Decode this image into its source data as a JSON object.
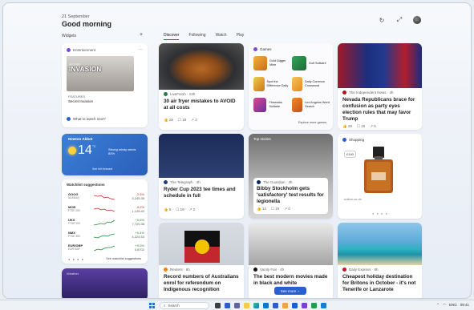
{
  "header": {
    "date": "21 September",
    "greeting": "Good morning"
  },
  "widgets_label": "Widgets",
  "tabs": [
    "Discover",
    "Following",
    "Watch",
    "Play"
  ],
  "entertainment": {
    "header": "Entertainment",
    "poster_small": "SECRET",
    "poster_title": "INVASION",
    "meta": "FEATURES",
    "subtitle": "Secret Invasion",
    "footer": "What to watch next?"
  },
  "weather": {
    "location": "Newton Abbot",
    "temp": "14",
    "unit": "°C",
    "desc1": "Strong windy winds",
    "desc2": "84%",
    "cta": "See full forecast"
  },
  "watchlist": {
    "title": "Watchlist suggestions",
    "rows": [
      {
        "symbol": "GOOG",
        "name": "NASDAQ",
        "change": "-2.6%",
        "price": "3,245.35",
        "trend": "neg"
      },
      {
        "symbol": "MCB",
        "name": "FTSE 250",
        "change": "-0.2%",
        "price": "1,128.40",
        "trend": "neg"
      },
      {
        "symbol": "UKX",
        "name": "FTSE 100",
        "change": "+0.6%",
        "price": "7,720.38",
        "trend": "pos"
      },
      {
        "symbol": "NMX",
        "name": "FTSE 350",
        "change": "+0.4%",
        "price": "4,224.53",
        "trend": "pos"
      },
      {
        "symbol": "EUR/GBP",
        "name": "EUR GBP",
        "change": "+0.9%",
        "price": "0.8702",
        "trend": "pos"
      }
    ],
    "footer": "See watchlist suggestions"
  },
  "storm_label": "Weather",
  "news": [
    {
      "source": "LiveFresh · 13h",
      "title": "30 air fryer mistakes to AVOID at all costs",
      "likes": "28",
      "comments": "19",
      "shares": "3"
    },
    {
      "source": "The Independent News · 4h",
      "title": "Nevada Republicans brace for confusion as party eyes election rules that may favor Trump",
      "likes": "29",
      "comments": "19",
      "shares": "5"
    },
    {
      "source": "The Telegraph · 4h",
      "title": "Ryder Cup 2023 tee times and schedule in full",
      "likes": "5",
      "comments": "19",
      "shares": "2"
    },
    {
      "source": "The Guardian · 3h",
      "title": "Bibby Stockholm gets 'satisfactory' test results for legionella",
      "likes": "14",
      "comments": "19",
      "shares": "0"
    },
    {
      "source": "Reuters · 6h",
      "title": "Record numbers of Australians enrol for referendum on Indigenous recognition"
    },
    {
      "source": "Vanity Fair · 4h",
      "title": "The best modern movies made in black and white"
    },
    {
      "source": "Daily Express · 8h",
      "title": "Cheapest holiday destination for Britons in October - it's not Tenerife or Lanzarote"
    }
  ],
  "games": {
    "header": "Games",
    "items": [
      "Gold Digger Mine",
      "Golf Solitaire",
      "Spot the Difference Daily",
      "Daily Common Crossword",
      "Fireworks Solitaire",
      "Lex Angelos Word Search"
    ],
    "footer": "Explore more games"
  },
  "topstories_label": "Top stories",
  "shopping": {
    "header": "Shopping",
    "price": "£140",
    "store": "notino.co.uk"
  },
  "see_more": "See more",
  "taskbar": {
    "search": "Search",
    "time": "09:41",
    "lang": "ENG"
  }
}
